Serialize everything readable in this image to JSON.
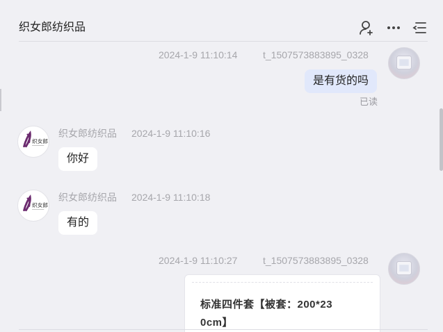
{
  "header": {
    "title": "织女郎纺织品",
    "icons": [
      "person-add-icon",
      "more-icon",
      "menu-list-icon"
    ]
  },
  "messages": [
    {
      "sender": "t_1507573883895_0328",
      "timestamp": "2024-1-9 11:10:14",
      "text": "是有货的吗",
      "status": "已读",
      "side": "right"
    },
    {
      "sender": "织女郎纺织品",
      "timestamp": "2024-1-9 11:10:16",
      "text": "你好",
      "side": "left"
    },
    {
      "sender": "织女郎纺织品",
      "timestamp": "2024-1-9 11:10:18",
      "text": "有的",
      "side": "left"
    },
    {
      "sender": "t_1507573883895_0328",
      "timestamp": "2024-1-9 11:10:27",
      "product_card": {
        "line1": "标准四件套【被套：200*23",
        "line2": "0cm】"
      },
      "side": "right"
    }
  ],
  "colors": {
    "background": "#f0f0f4",
    "mine_bubble": "#e1e8fb",
    "theirs_bubble": "#ffffff",
    "meta_text": "#a6a6ab",
    "logo_purple": "#6b2a6e"
  }
}
